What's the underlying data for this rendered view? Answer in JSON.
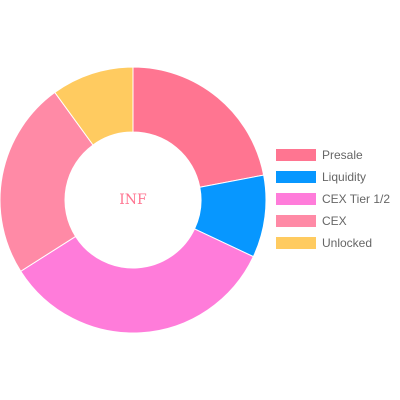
{
  "chart_data": {
    "type": "pie",
    "donut": true,
    "center_text": "INF",
    "legend_position": "right",
    "categories": [
      "Presale",
      "Liquidity",
      "CEX Tier 1/2",
      "CEX",
      "Unlocked"
    ],
    "values": [
      22,
      10,
      34,
      24,
      10
    ],
    "colors": [
      "#ff7591",
      "#0797ff",
      "#ff7cda",
      "#ff8aa6",
      "#ffcb60"
    ]
  },
  "colors": {
    "center_text": "#ff7591",
    "legend_text": "#666666"
  }
}
